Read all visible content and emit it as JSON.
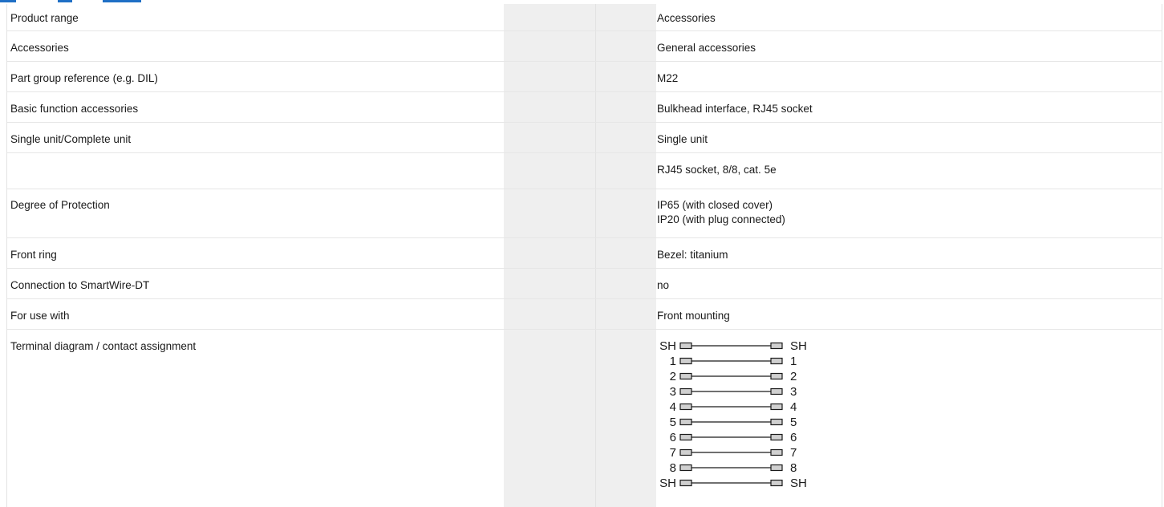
{
  "spec_table": {
    "rows": [
      {
        "label": "Product range",
        "value": "Accessories"
      },
      {
        "label": "Accessories",
        "value": "General accessories"
      },
      {
        "label": "Part group reference (e.g. DIL)",
        "value": "M22"
      },
      {
        "label": "Basic function accessories",
        "value": "Bulkhead interface, RJ45 socket"
      },
      {
        "label": "Single unit/Complete unit",
        "value": "Single unit"
      },
      {
        "label": "",
        "value": "RJ45 socket, 8/8, cat. 5e"
      },
      {
        "label": "Degree of Protection",
        "value_lines": [
          "IP65 (with closed cover)",
          "IP20 (with plug connected)"
        ]
      },
      {
        "label": "Front ring",
        "value": "Bezel: titanium"
      },
      {
        "label": "Connection to SmartWire-DT",
        "value": "no"
      },
      {
        "label": "For use with",
        "value": "Front mounting"
      },
      {
        "label": "Terminal diagram / contact assignment"
      }
    ]
  },
  "terminal_diagram": {
    "pins": [
      "SH",
      "1",
      "2",
      "3",
      "4",
      "5",
      "6",
      "7",
      "8",
      "SH"
    ]
  },
  "colors": {
    "accent": "#1f6fc5",
    "shade_column": "#efefef",
    "divider": "#e6e6e6",
    "terminal_fill": "#d0d0d0"
  }
}
